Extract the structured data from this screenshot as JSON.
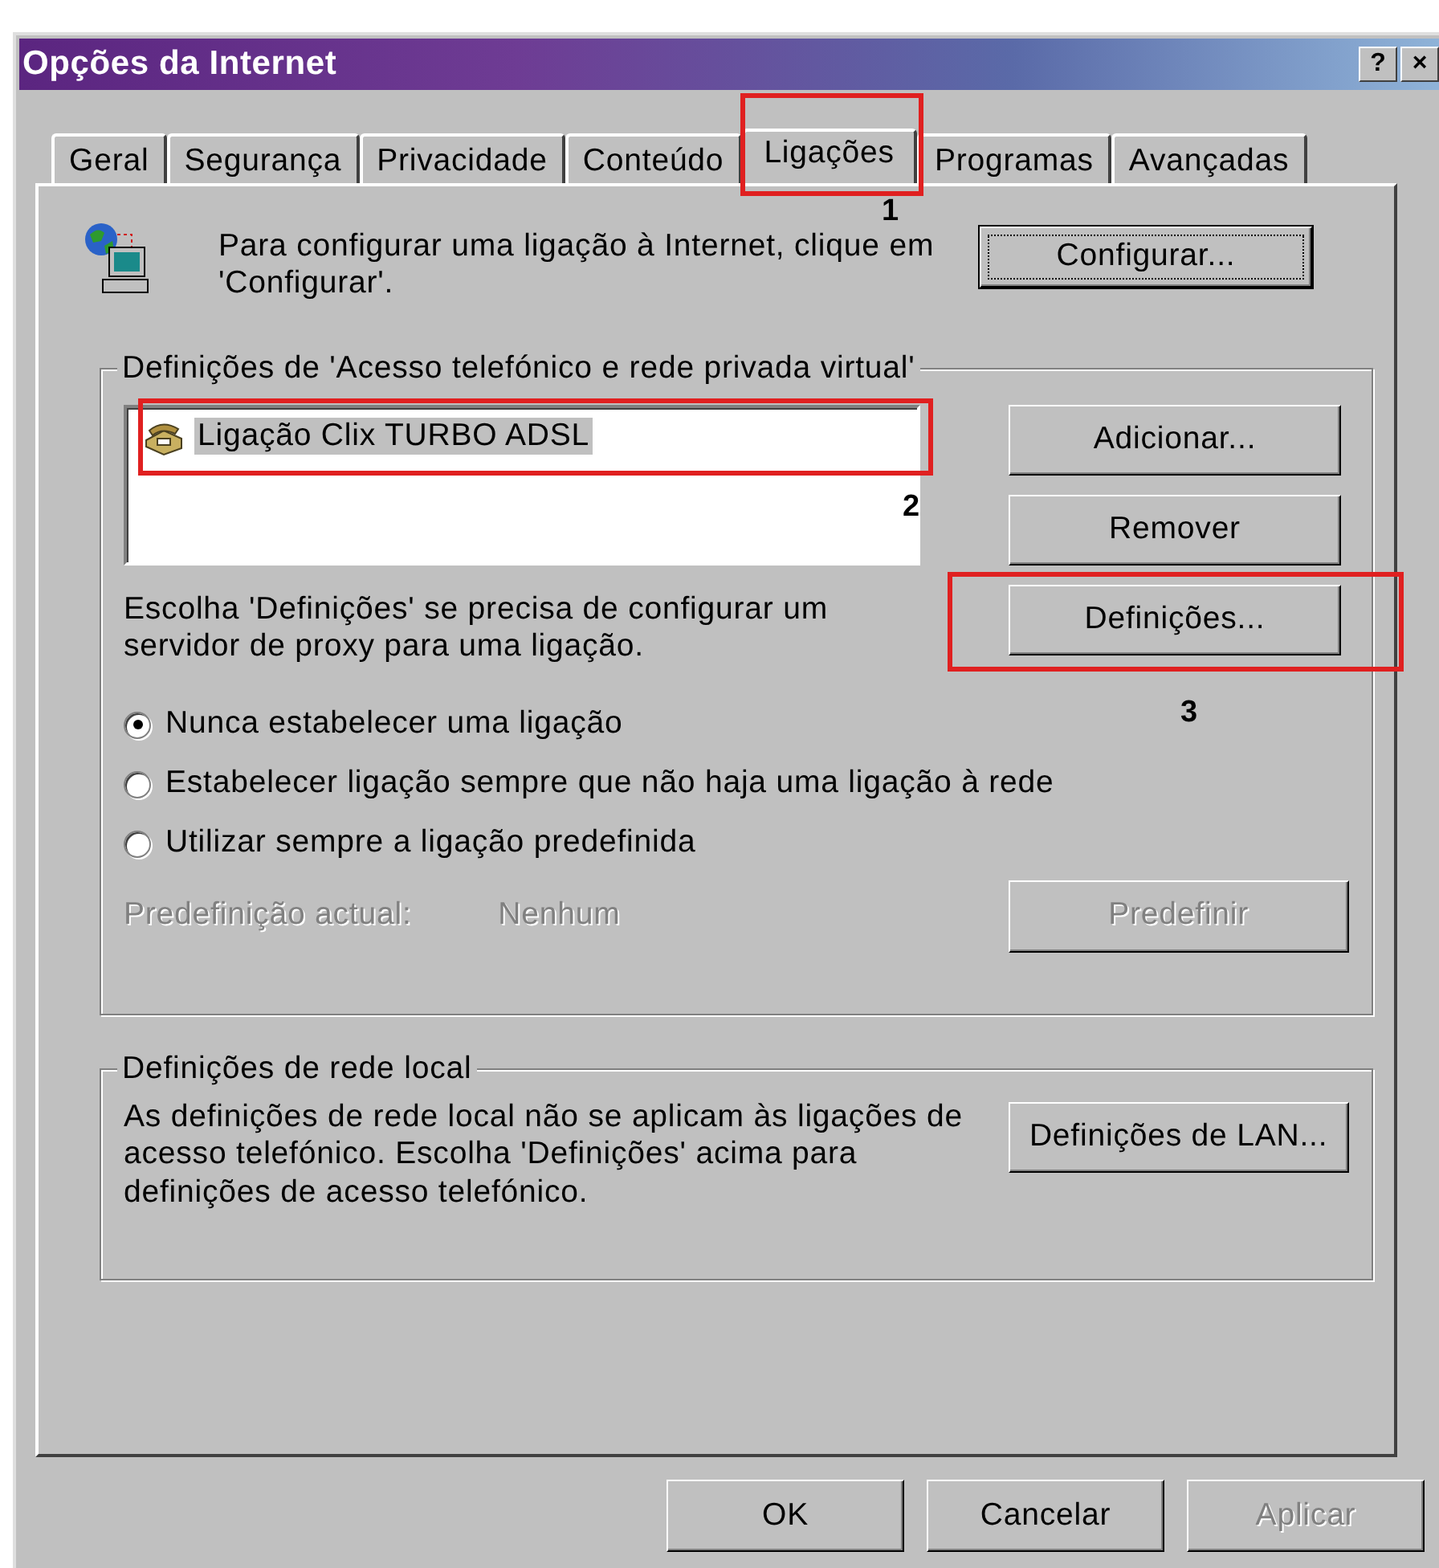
{
  "window": {
    "title": "Opções da Internet",
    "help_button": "?",
    "close_button": "×"
  },
  "tabs": [
    {
      "label": "Geral",
      "selected": false
    },
    {
      "label": "Segurança",
      "selected": false
    },
    {
      "label": "Privacidade",
      "selected": false
    },
    {
      "label": "Conteúdo",
      "selected": false
    },
    {
      "label": "Ligações",
      "selected": true,
      "annotation": "1"
    },
    {
      "label": "Programas",
      "selected": false
    },
    {
      "label": "Avançadas",
      "selected": false
    }
  ],
  "setup": {
    "text": "Para configurar uma ligação à Internet, clique em 'Configurar'.",
    "button": "Configurar..."
  },
  "dialup": {
    "legend": "Definições de 'Acesso telefónico e rede privada virtual'",
    "connections": [
      {
        "name": "Ligação Clix TURBO ADSL",
        "selected": true,
        "annotation": "2"
      }
    ],
    "buttons": [
      {
        "label": "Adicionar...",
        "disabled": false
      },
      {
        "label": "Remover",
        "disabled": false
      },
      {
        "label": "Definições...",
        "disabled": false,
        "annotation": "3"
      }
    ],
    "proxy_text": "Escolha 'Definições' se precisa de configurar um servidor de proxy para uma ligação.",
    "options": [
      {
        "label": "Nunca estabelecer uma ligação",
        "selected": true
      },
      {
        "label": "Estabelecer ligação sempre que não haja uma ligação à rede",
        "selected": false
      },
      {
        "label": "Utilizar sempre a ligação predefinida",
        "selected": false
      }
    ],
    "current_default": {
      "label": "Predefinição actual:",
      "value": "Nenhum",
      "disabled": true
    },
    "set_default_button": {
      "label": "Predefinir",
      "disabled": true
    }
  },
  "lan": {
    "legend": "Definições de rede local",
    "text": "As definições de rede local não se aplicam às ligações de acesso telefónico. Escolha 'Definições' acima para definições de acesso telefónico.",
    "button": "Definições de LAN..."
  },
  "footer_buttons": [
    {
      "label": "OK",
      "disabled": false
    },
    {
      "label": "Cancelar",
      "disabled": false
    },
    {
      "label": "Aplicar",
      "disabled": true
    }
  ]
}
